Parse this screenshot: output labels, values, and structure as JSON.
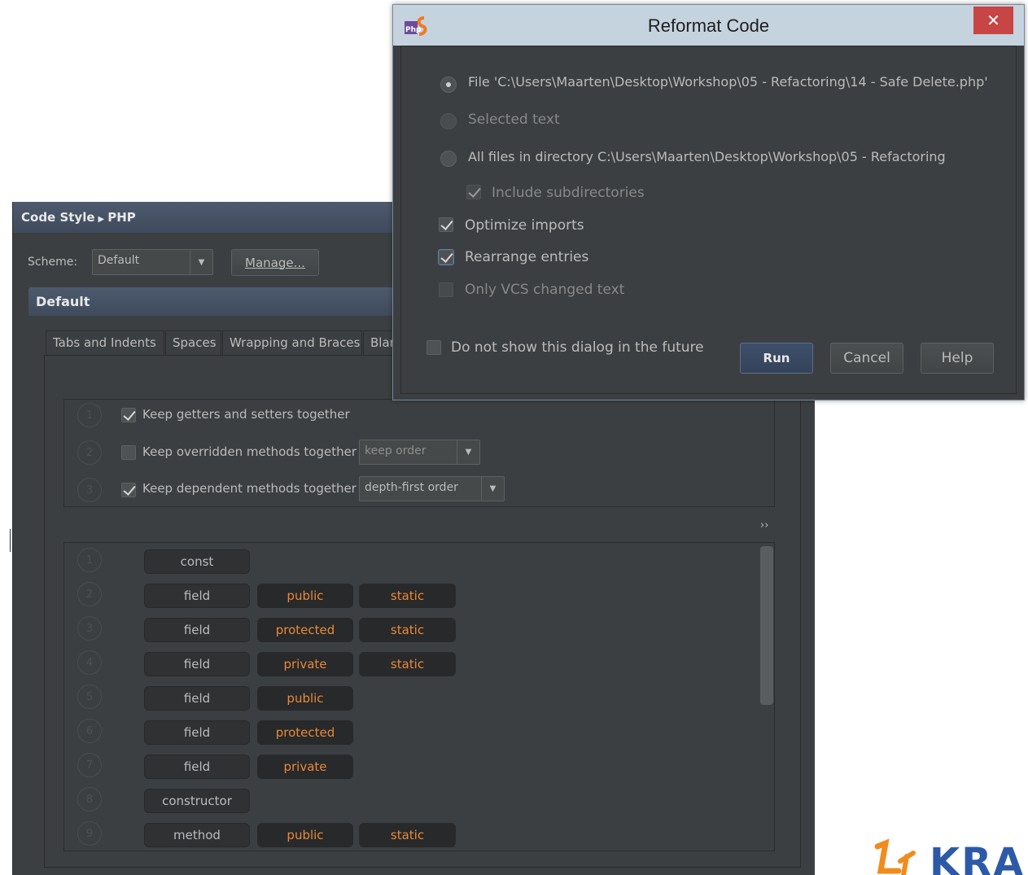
{
  "code_style": {
    "breadcrumb_a": "Code Style",
    "breadcrumb_b": "PHP",
    "scheme_label": "Scheme:",
    "scheme_value": "Default",
    "manage_label": "Manage...",
    "section_title": "Default",
    "tabs": [
      "Tabs and Indents",
      "Spaces",
      "Wrapping and Braces",
      "Blan"
    ],
    "grouping": [
      {
        "num": "1",
        "label": "Keep getters and setters together",
        "checked": true
      },
      {
        "num": "2",
        "label": "Keep overridden methods together",
        "checked": false,
        "combo": "keep order"
      },
      {
        "num": "3",
        "label": "Keep dependent methods together",
        "checked": true,
        "combo": "depth-first order"
      }
    ],
    "more_icon": "››",
    "rules": [
      {
        "num": "1",
        "kind": "const"
      },
      {
        "num": "2",
        "kind": "field",
        "access": "public",
        "mod": "static"
      },
      {
        "num": "3",
        "kind": "field",
        "access": "protected",
        "mod": "static"
      },
      {
        "num": "4",
        "kind": "field",
        "access": "private",
        "mod": "static"
      },
      {
        "num": "5",
        "kind": "field",
        "access": "public"
      },
      {
        "num": "6",
        "kind": "field",
        "access": "protected"
      },
      {
        "num": "7",
        "kind": "field",
        "access": "private"
      },
      {
        "num": "8",
        "kind": "constructor"
      },
      {
        "num": "9",
        "kind": "method",
        "access": "public",
        "mod": "static"
      }
    ]
  },
  "dialog": {
    "title": "Reformat Code",
    "close": "✕",
    "file_option": "File 'C:\\Users\\Maarten\\Desktop\\Workshop\\05 - Refactoring\\14 - Safe Delete.php'",
    "selected_text": "Selected text",
    "all_files": "All files in directory C:\\Users\\Maarten\\Desktop\\Workshop\\05 - Refactoring",
    "include_sub": "Include subdirectories",
    "optimize_imports": "Optimize imports",
    "rearrange_entries": "Rearrange entries",
    "only_vcs": "Only VCS changed text",
    "do_not_show": "Do not show this dialog in the future",
    "run": "Run",
    "cancel": "Cancel",
    "help": "Help"
  },
  "logo_text": "KRA",
  "colors": {
    "accent_orange": "#e8893a",
    "header_blue": "#4d5a6e",
    "bg": "#3c3f41"
  }
}
